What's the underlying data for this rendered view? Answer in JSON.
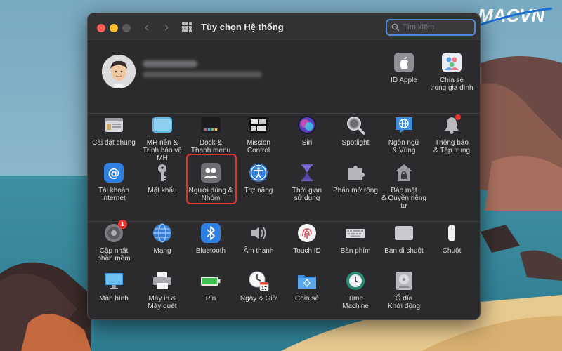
{
  "window": {
    "title": "Tùy chọn Hệ thống",
    "back_glyph": "‹",
    "forward_glyph": "›"
  },
  "search": {
    "placeholder": "Tìm kiếm",
    "value": ""
  },
  "account": {
    "items": [
      {
        "label": "ID Apple",
        "icon": "apple-id-icon"
      },
      {
        "label": "Chia sẻ\ntrong gia đình",
        "icon": "family-sharing-icon"
      }
    ]
  },
  "section1": {
    "items": [
      {
        "label": "Cài đặt chung",
        "icon": "general-icon"
      },
      {
        "label": "MH nền &\nTrình bảo vệ MH",
        "icon": "desktop-screensaver-icon"
      },
      {
        "label": "Dock &\nThanh menu",
        "icon": "dock-icon"
      },
      {
        "label": "Mission\nControl",
        "icon": "mission-control-icon"
      },
      {
        "label": "Siri",
        "icon": "siri-icon"
      },
      {
        "label": "Spotlight",
        "icon": "spotlight-icon"
      },
      {
        "label": "Ngôn ngữ\n& Vùng",
        "icon": "language-region-icon"
      },
      {
        "label": "Thông báo\n& Tập trung",
        "icon": "notifications-icon"
      },
      {
        "label": "Tài khoản\ninternet",
        "icon": "internet-accounts-icon"
      },
      {
        "label": "Mật khẩu",
        "icon": "passwords-icon"
      },
      {
        "label": "Người dùng &\nNhóm",
        "icon": "users-groups-icon"
      },
      {
        "label": "Trợ năng",
        "icon": "accessibility-icon"
      },
      {
        "label": "Thời gian\nsử dụng",
        "icon": "screen-time-icon"
      },
      {
        "label": "Phần mở rộng",
        "icon": "extensions-icon"
      },
      {
        "label": "Bảo mật\n& Quyền riêng tư",
        "icon": "security-privacy-icon"
      }
    ]
  },
  "section2": {
    "items": [
      {
        "label": "Cập nhật\nphần mềm",
        "icon": "software-update-icon",
        "badge": "1"
      },
      {
        "label": "Mạng",
        "icon": "network-icon"
      },
      {
        "label": "Bluetooth",
        "icon": "bluetooth-icon"
      },
      {
        "label": "Âm thanh",
        "icon": "sound-icon"
      },
      {
        "label": "Touch ID",
        "icon": "touch-id-icon"
      },
      {
        "label": "Bàn phím",
        "icon": "keyboard-icon"
      },
      {
        "label": "Bàn di chuột",
        "icon": "trackpad-icon"
      },
      {
        "label": "Chuột",
        "icon": "mouse-icon"
      },
      {
        "label": "Màn hình",
        "icon": "displays-icon"
      },
      {
        "label": "Máy in &\nMáy quét",
        "icon": "printers-icon"
      },
      {
        "label": "Pin",
        "icon": "battery-icon"
      },
      {
        "label": "Ngày & Giờ",
        "icon": "date-time-icon",
        "calendar_day": "17"
      },
      {
        "label": "Chia sẻ",
        "icon": "sharing-icon"
      },
      {
        "label": "Time\nMachine",
        "icon": "time-machine-icon"
      },
      {
        "label": "Ổ đĩa\nKhởi động",
        "icon": "startup-disk-icon"
      }
    ]
  },
  "logo": {
    "text": "MACVN"
  },
  "colors": {
    "highlight": "#e0342b",
    "accent": "#4d8ad8"
  }
}
